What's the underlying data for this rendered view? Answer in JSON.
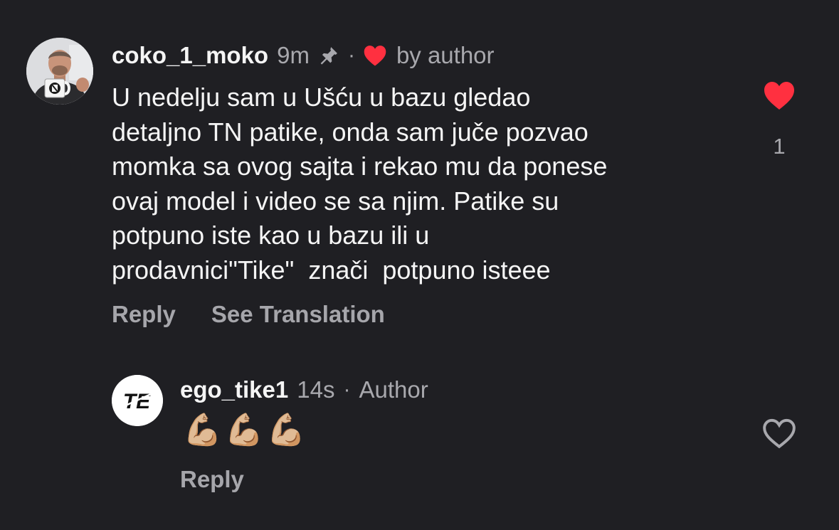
{
  "comment": {
    "username": "coko_1_moko",
    "time": "9m",
    "separator": "·",
    "liked_by": "by author",
    "text": "U nedelju sam u Ušću u bazu gledao\ndetaljno TN patike, onda sam juče pozvao\nmomka sa ovog sajta i rekao mu da ponese\novaj model i video se sa njim. Patike su\npotpuno iste kao u bazu ili u\nprodavnici\"Tike\"  znači  potpuno isteee",
    "like_count": "1",
    "reply_label": "Reply",
    "translate_label": "See Translation",
    "like_icon": "heart-filled-icon",
    "like_color": "#ff3040"
  },
  "reply": {
    "username": "ego_tike1",
    "time": "14s",
    "separator": "·",
    "badge": "Author",
    "text": "💪🏼💪🏼💪🏼",
    "reply_label": "Reply",
    "logo_text": "TE",
    "like_icon": "heart-outline-icon"
  }
}
